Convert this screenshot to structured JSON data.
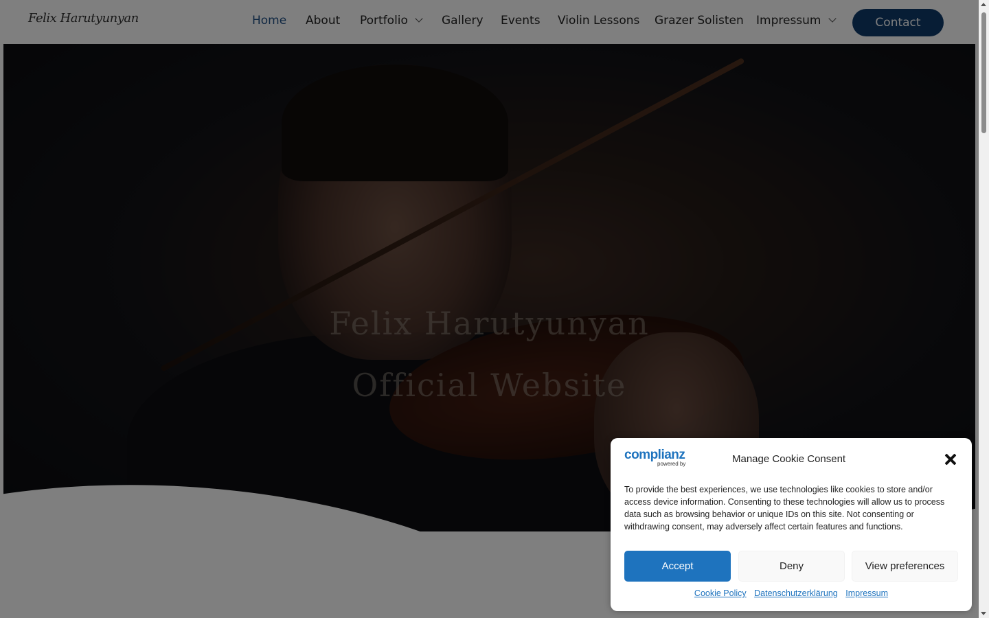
{
  "header": {
    "logo": "Felix Harutyunyan",
    "nav": [
      {
        "label": "Home",
        "active": true
      },
      {
        "label": "About"
      },
      {
        "label": "Portfolio",
        "dropdown": true
      },
      {
        "label": "Gallery"
      },
      {
        "label": "Events"
      },
      {
        "label": "Violin Lessons"
      },
      {
        "label": "Grazer Solisten"
      },
      {
        "label": "Impressum",
        "dropdown": true
      }
    ],
    "contact_label": "Contact"
  },
  "hero": {
    "title_line1": "Felix Harutyunyan",
    "title_line2": "Official Website"
  },
  "cookie": {
    "brand": "complianz",
    "brand_sub": "powered by",
    "title": "Manage Cookie Consent",
    "text": "To provide the best experiences, we use technologies like cookies to store and/or access device information. Consenting to these technologies will allow us to process data such as browsing behavior or unique IDs on this site. Not consenting or withdrawing consent, may adversely affect certain features and functions.",
    "accept": "Accept",
    "deny": "Deny",
    "preferences": "View preferences",
    "links": [
      "Cookie Policy",
      "Datenschutzerklärung",
      "Impressum"
    ]
  },
  "colors": {
    "nav_active": "#1f4e85",
    "contact_bg": "#0e3a6b",
    "accept_bg": "#1e73be"
  }
}
